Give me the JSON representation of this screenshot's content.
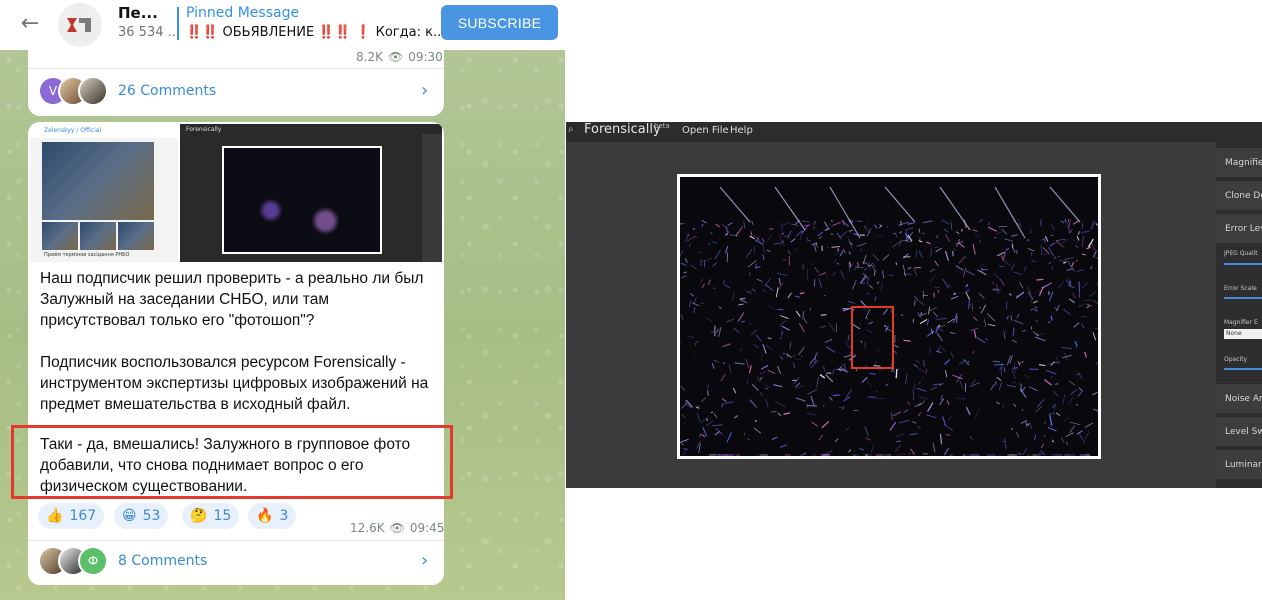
{
  "telegram": {
    "header": {
      "channel_name": "Пе...",
      "subscribers": "36 534 ...",
      "pinned_label": "Pinned Message",
      "pinned_emoji_1": "‼️‼️",
      "pinned_word": "ОБЬЯВЛЕНИЕ",
      "pinned_emoji_2": "‼️‼️ ❗",
      "pinned_tail": "Когда: к...",
      "subscribe_label": "SUBSCRIBE"
    },
    "post_a": {
      "views": "8.2K",
      "time": "09:30",
      "avatar_letter": "V",
      "comments": "26 Comments"
    },
    "post_b": {
      "thumb_channel": "Zelenskyy / Official",
      "thumb_caption": "Приём термінов засідання РНБО",
      "thumb2_title": "Forensically",
      "paragraph_1": "Наш подписчик решил проверить - а реально ли был Залужный на заседании СНБО, или там присутствовал только его \"фотошоп\"?",
      "paragraph_2": "Подписчик воспользовался ресурсом Forensically - инструментом экспертизы цифровых изображений на предмет вмешательства в исходный файл.",
      "paragraph_3": "Таки - да, вмешались! Залужного в групповое фото добавили, что снова поднимает вопрос о его физическом существовании.",
      "reactions": [
        {
          "emoji": "👍",
          "count": "167"
        },
        {
          "emoji": "😁",
          "count": "53"
        },
        {
          "emoji": "🤔",
          "count": "15"
        },
        {
          "emoji": "🔥",
          "count": "3"
        }
      ],
      "views": "12.6K",
      "time": "09:45",
      "avatar_letter": "Ф",
      "comments": "8 Comments"
    }
  },
  "forensically": {
    "title": "Forensically",
    "beta": "beta",
    "menu": [
      "Open File",
      "Help"
    ],
    "tools": [
      "Magnifier",
      "Clone De",
      "Error Lev",
      "Noise An",
      "Level Swe",
      "Luminanc"
    ],
    "settings": {
      "jpeg_quality": "JPEG Qualit",
      "error_scale": "Error Scale",
      "magnifier_e": "Magnifier E",
      "magnifier_value": "None",
      "opacity": "Opacity"
    }
  },
  "colors": {
    "accent": "#3390ec",
    "subscribe": "#4a95e2",
    "highlight_red": "#e33a2e",
    "telegram_bg": "#a9bf8b"
  }
}
